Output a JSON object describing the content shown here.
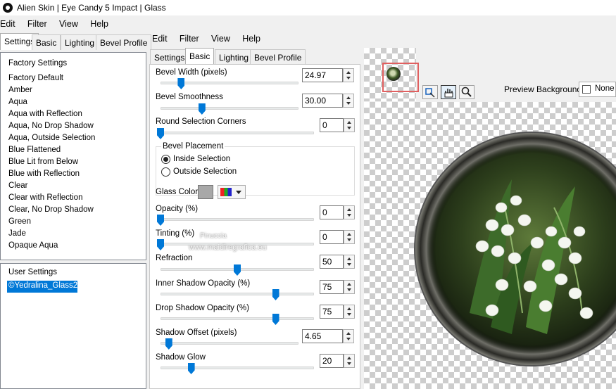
{
  "window": {
    "title": "Alien Skin | Eye Candy 5 Impact | Glass"
  },
  "menu": {
    "items": [
      "Edit",
      "Filter",
      "View",
      "Help"
    ]
  },
  "left_tabs": [
    "Settings",
    "Basic",
    "Lighting",
    "Bevel Profile"
  ],
  "center_tabs": [
    "Settings",
    "Basic",
    "Lighting",
    "Bevel Profile"
  ],
  "settings": {
    "factory_header": "Factory Settings",
    "factory_items": [
      "Factory Default",
      "Amber",
      "Aqua",
      "Aqua with Reflection",
      "Aqua, No Drop Shadow",
      "Aqua, Outside Selection",
      "Blue Flattened",
      "Blue Lit from Below",
      "Blue with Reflection",
      "Clear",
      "Clear with Reflection",
      "Clear, No Drop Shadow",
      "Green",
      "Jade",
      "Opaque Aqua"
    ],
    "user_header": "User Settings",
    "user_items": [
      "©Yedralina_Glass2"
    ]
  },
  "controls": {
    "bevel_width": {
      "label": "Bevel Width (pixels)",
      "value": "24.97",
      "level": 0.15
    },
    "bevel_smoothness": {
      "label": "Bevel Smoothness",
      "value": "30.00",
      "level": 0.3
    },
    "round_corners": {
      "label": "Round Selection Corners",
      "value": "0",
      "level": 0.0
    },
    "bevel_placement": {
      "label": "Bevel Placement",
      "option_inside": "Inside Selection",
      "option_outside": "Outside Selection",
      "selected": "Inside Selection"
    },
    "glass_color": {
      "label": "Glass Color",
      "swatch": "#a8a8a8"
    },
    "opacity": {
      "label": "Opacity (%)",
      "value": "0",
      "level": 0.0
    },
    "tinting": {
      "label": "Tinting (%)",
      "value": "0",
      "level": 0.0
    },
    "refraction": {
      "label": "Refraction",
      "value": "50",
      "level": 0.5
    },
    "inner_shadow_opacity": {
      "label": "Inner Shadow Opacity (%)",
      "value": "75",
      "level": 0.75
    },
    "drop_shadow_opacity": {
      "label": "Drop Shadow Opacity (%)",
      "value": "75",
      "level": 0.75
    },
    "shadow_offset": {
      "label": "Shadow Offset (pixels)",
      "value": "4.65",
      "level": 0.06
    },
    "shadow_glow": {
      "label": "Shadow Glow",
      "value": "20",
      "level": 0.2
    }
  },
  "preview": {
    "background_label": "Preview Background:",
    "background_value": "None"
  },
  "watermark": {
    "line1": "Pinuccia",
    "line2": "www.maidiregrafica.eu"
  },
  "colors": {
    "accent": "#0078d7",
    "selection": "#0078d7"
  }
}
